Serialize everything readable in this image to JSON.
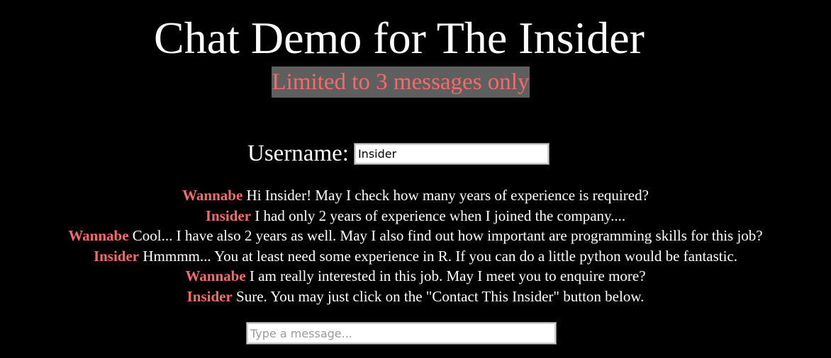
{
  "page": {
    "title": "Chat Demo for The Insider",
    "limit_notice": "Limited to 3 messages only"
  },
  "colors": {
    "background": "#000000",
    "text": "#ffffff",
    "accent": "#f56a6a",
    "notice_background": "#5f5f5f"
  },
  "username": {
    "label": "Username:",
    "value": "Insider"
  },
  "messages": [
    {
      "sender": "Wannabe",
      "text": "Hi Insider! May I check how many years of experience is required?"
    },
    {
      "sender": "Insider",
      "text": "I had only 2 years of experience when I joined the company...."
    },
    {
      "sender": "Wannabe",
      "text": "Cool... I have also 2 years as well. May I also find out how important are programming skills for this job?"
    },
    {
      "sender": "Insider",
      "text": "Hmmmm... You at least need some experience in R. If you can do a little python would be fantastic."
    },
    {
      "sender": "Wannabe",
      "text": "I am really interested in this job. May I meet you to enquire more?"
    },
    {
      "sender": "Insider",
      "text": "Sure. You may just click on the \"Contact This Insider\" button below."
    }
  ],
  "composer": {
    "placeholder": "Type a message..."
  }
}
